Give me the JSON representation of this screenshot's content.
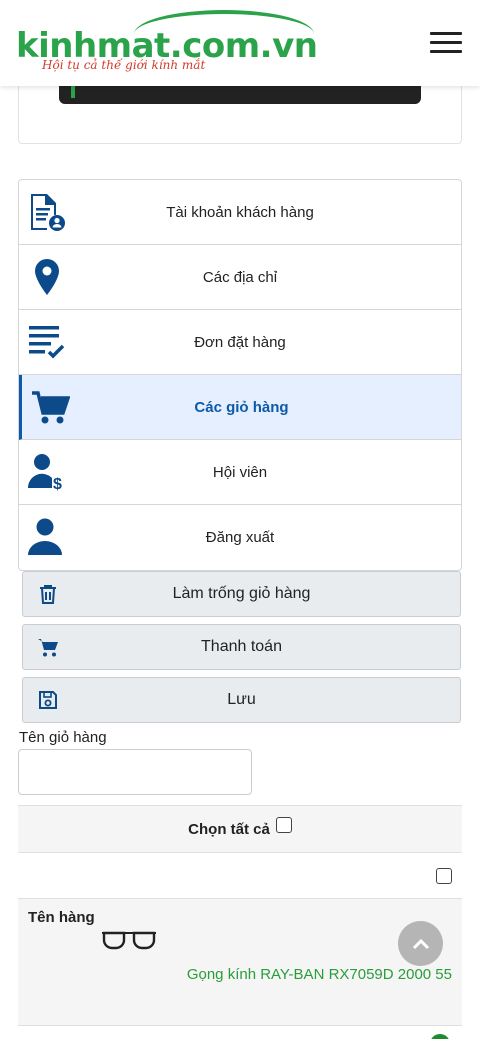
{
  "header": {
    "logo_text": "kinhmat.com.vn",
    "logo_tagline": "Hội tụ cả thế giới kính mắt",
    "menu_icon": "hamburger-menu-icon"
  },
  "colors": {
    "brand_green": "#2aa34a",
    "tagline_red": "#d23b2c",
    "active_blue": "#0d5aa7",
    "active_bg": "#e5efff",
    "product_link": "#2a9d3a"
  },
  "account_menu": {
    "items": [
      {
        "label": "Tài khoản khách hàng",
        "icon": "user-document-icon"
      },
      {
        "label": "Các địa chỉ",
        "icon": "map-pin-icon"
      },
      {
        "label": "Đơn đặt hàng",
        "icon": "order-list-check-icon"
      },
      {
        "label": "Các giỏ hàng",
        "icon": "shopping-cart-icon",
        "active": true
      },
      {
        "label": "Hội viên",
        "icon": "member-dollar-icon"
      },
      {
        "label": "Đăng xuất",
        "icon": "user-logout-icon"
      }
    ]
  },
  "actions": {
    "empty_cart": "Làm trống giỏ hàng",
    "checkout": "Thanh toán",
    "save": "Lưu"
  },
  "cart_form": {
    "name_label": "Tên giỏ hàng",
    "name_value": "",
    "select_all": "Chọn tất cả"
  },
  "cart_table": {
    "product_header": "Tên hàng",
    "rows": [
      {
        "name": "Gọng kính RAY-BAN RX7059D 2000 55"
      }
    ]
  }
}
